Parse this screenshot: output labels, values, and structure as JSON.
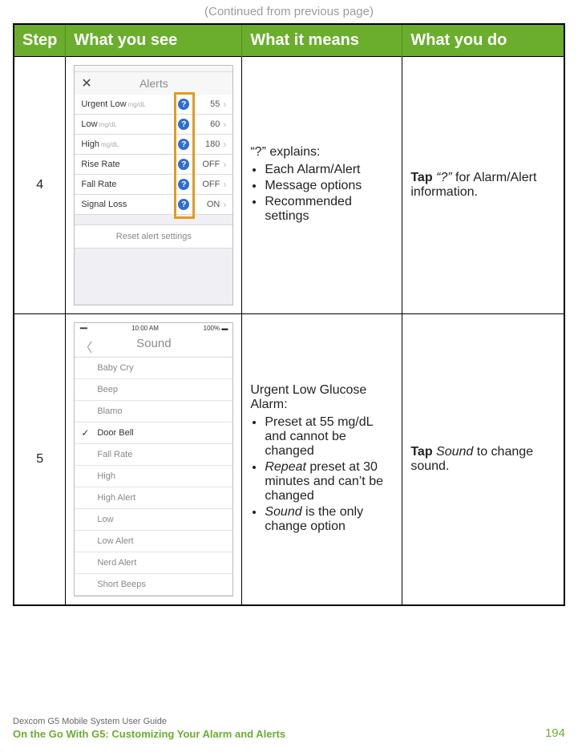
{
  "continued": "(Continued from previous page)",
  "headers": {
    "step": "Step",
    "see": "What you see",
    "means": "What it means",
    "do": "What you do"
  },
  "row4": {
    "step": "4",
    "means_lead": "“?” explains:",
    "means_items": [
      "Each Alarm/Alert",
      "Message options",
      "Recommended settings"
    ],
    "do_pre": "Tap ",
    "do_ital": "“?” ",
    "do_post": "for Alarm/Alert information.",
    "screen": {
      "title": "Alerts",
      "rows": [
        {
          "label": "Urgent Low",
          "unit": "mg/dL",
          "val": "55"
        },
        {
          "label": "Low",
          "unit": "mg/dL",
          "val": "60"
        },
        {
          "label": "High",
          "unit": "mg/dL",
          "val": "180"
        },
        {
          "label": "Rise Rate",
          "unit": "",
          "val": "OFF"
        },
        {
          "label": "Fall Rate",
          "unit": "",
          "val": "OFF"
        },
        {
          "label": "Signal Loss",
          "unit": "",
          "val": "ON"
        }
      ],
      "reset": "Reset alert settings"
    }
  },
  "row5": {
    "step": "5",
    "means_lead": "Urgent Low Glucose Alarm:",
    "means_items": [
      {
        "pre": "Preset at 55 mg/dL and cannot be changed"
      },
      {
        "ital": "Repeat",
        "post": " preset at 30 minutes and can’t be changed"
      },
      {
        "ital": "Sound",
        "post": " is the only change option"
      }
    ],
    "do_pre": "Tap ",
    "do_ital": "Sound",
    "do_post": " to change sound.",
    "screen": {
      "time": "10:00 AM",
      "batt": "100%",
      "title": "Sound",
      "rows": [
        "Baby Cry",
        "Beep",
        "Blamo",
        "Door Bell",
        "Fall Rate",
        "High",
        "High Alert",
        "Low",
        "Low Alert",
        "Nerd Alert",
        "Short Beeps"
      ],
      "selected_index": 3
    }
  },
  "footer": {
    "guide": "Dexcom G5 Mobile System User Guide",
    "chapter": "On the Go With G5: Customizing Your Alarm and Alerts",
    "page": "194"
  }
}
